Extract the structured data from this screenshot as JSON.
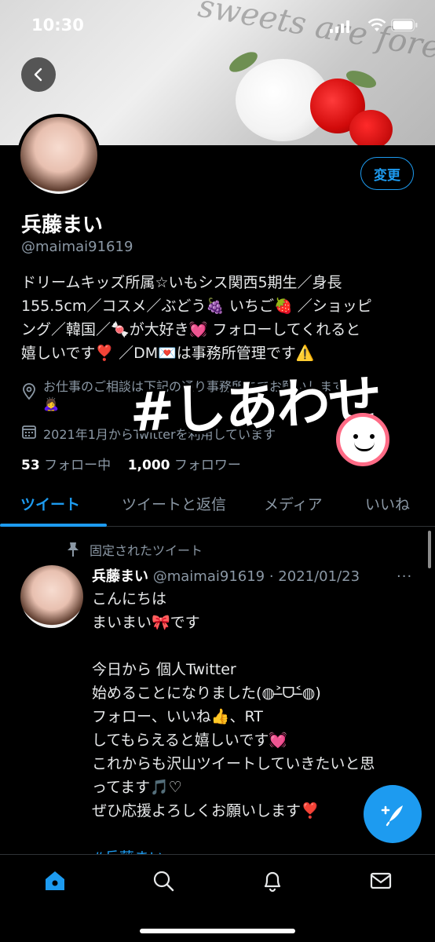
{
  "status_bar": {
    "time": "10:30"
  },
  "banner": {
    "script_text": "sweets are forever."
  },
  "profile": {
    "edit_label": "変更",
    "name": "兵藤まい",
    "handle": "@maimai91619",
    "bio_lines": [
      "ドリームキッズ所属☆いもシス関西5期生／身長",
      "155.5cm／コスメ／ぶどう🍇 いちご🍓 ／ショッピ",
      "ング／韓国／🍬が大好き💓 フォローしてくれると",
      "嬉しいです❣️ ／DM💌は事務所管理です⚠️"
    ],
    "location": "お仕事のご相談は下記の通り事務所までお願いします",
    "location_emoji": "🙇‍♀️",
    "joined": "2021年1月からTwitterを利用しています",
    "following_count": "53",
    "following_label": "フォロー中",
    "followers_count": "1,000",
    "followers_label": "フォロワー",
    "sticker_text": "#しあわせ"
  },
  "tabs": [
    {
      "label": "ツイート",
      "active": true
    },
    {
      "label": "ツイートと返信",
      "active": false
    },
    {
      "label": "メディア",
      "active": false
    },
    {
      "label": "いいね",
      "active": false
    }
  ],
  "tweet": {
    "pinned_label": "固定されたツイート",
    "author": "兵藤まい",
    "handle_date": "@maimai91619 · 2021/01/23",
    "more": "···",
    "lines": [
      "こんにちは",
      "まいまい🎀です",
      "",
      "今日から 個人Twitter",
      "始めることになりました(◍˃̶ᗜ˂̶◍)",
      "フォロー、いいね👍、RT",
      "してもらえると嬉しいです💓",
      "これからも沢山ツイートしていきたいと思",
      "ってます🎵♡",
      "ぜひ応援よろしくお願いします❣️",
      ""
    ],
    "hashtag": "#兵藤まい"
  },
  "nav": {
    "items": [
      "home-icon",
      "search-icon",
      "notifications-icon",
      "messages-icon"
    ],
    "accent": "#1d9bf0"
  }
}
